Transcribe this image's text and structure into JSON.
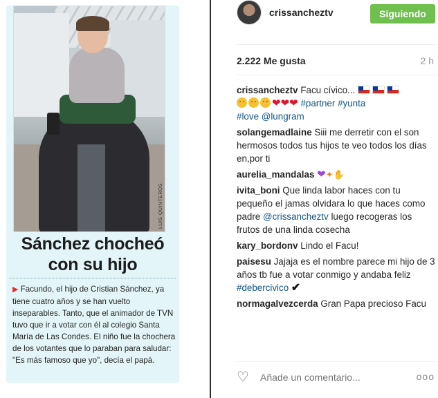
{
  "clipping": {
    "photo_credit": "LUIS QUINTEROS",
    "headline_line1": "Sánchez chocheó",
    "headline_line2": "con su hijo",
    "arrow": "▶",
    "body": "Facundo, el hijo de Cristian Sánchez, ya tiene cuatro años y se han vuelto inseparables. Tanto, que el animador de TVN tuvo que ir a votar con él al colegio Santa María de Las Condes. El niño fue la chochera de los votantes que lo paraban para saludar: \"Es más famoso que yo\", decía el papá."
  },
  "instagram": {
    "username": "crissancheztv",
    "follow_label": "Siguiendo",
    "likes": "2.222 Me gusta",
    "time": "2 h",
    "caption_user": "crissancheztv",
    "caption_text": "Facu cívico...",
    "caption_tags": "#partner #yunta",
    "caption_tags2": "#love @lungram",
    "comments": [
      {
        "user": "solangemadlaine",
        "text": "Siii me derretir con el son hermosos todos tus hijos te veo todos los días en,por ti"
      },
      {
        "user": "aurelia_mandalas",
        "text": ""
      },
      {
        "user": "ivita_boni",
        "text": "Que linda labor haces con tu pequeño el jamas olvidara lo que haces como padre",
        "tag": "@crissancheztv",
        "text2": "luego recogeras los frutos de una linda cosecha"
      },
      {
        "user": "kary_bordonv",
        "text": "Lindo el Facu!"
      },
      {
        "user": "paisesu",
        "text": "Jajaja es el nombre parece mi hijo de 3 años tb fue a votar conmigo y andaba feliz",
        "tag": "#debercivico",
        "text2": "✔"
      },
      {
        "user": "normagalvezcerda",
        "text": "Gran Papa precioso Facu"
      }
    ],
    "comment_placeholder": "Añade un comentario...",
    "more_label": "ooo",
    "icons": {
      "like": "heart-outline-icon",
      "more": "more-options-icon",
      "flag": "chile-flag-icon"
    }
  }
}
